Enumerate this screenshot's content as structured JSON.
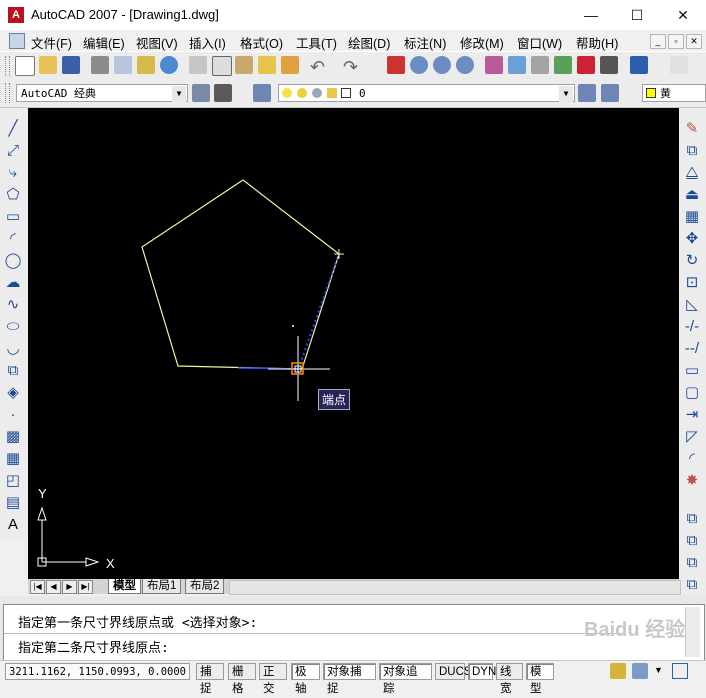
{
  "window": {
    "title": "AutoCAD 2007 - [Drawing1.dwg]",
    "app_icon_glyph": "A",
    "minimize": "—",
    "maximize": "☐",
    "close": "✕"
  },
  "menu": [
    "文件(F)",
    "编辑(E)",
    "视图(V)",
    "插入(I)",
    "格式(O)",
    "工具(T)",
    "绘图(D)",
    "标注(N)",
    "修改(M)",
    "窗口(W)",
    "帮助(H)"
  ],
  "mdi_controls": [
    "_",
    "▫",
    "✕"
  ],
  "toolbar2": {
    "workspace": "AutoCAD 经典",
    "layer": "0",
    "color": "黄"
  },
  "drawing": {
    "osnap_tooltip": "端点",
    "ucs_x": "X",
    "ucs_y": "Y"
  },
  "tabs": {
    "nav": [
      "|◀",
      "◀",
      "▶",
      "▶|"
    ],
    "items": [
      "模型",
      "布局1",
      "布局2"
    ],
    "active": "模型"
  },
  "command": {
    "line1": "指定第一条尺寸界线原点或 <选择对象>:",
    "line2": "指定第二条尺寸界线原点:"
  },
  "status": {
    "coords": "3211.1162, 1150.0993, 0.0000",
    "buttons": [
      {
        "label": "捕捉",
        "on": false
      },
      {
        "label": "栅格",
        "on": false
      },
      {
        "label": "正交",
        "on": false
      },
      {
        "label": "极轴",
        "on": true
      },
      {
        "label": "对象捕捉",
        "on": true
      },
      {
        "label": "对象追踪",
        "on": true
      },
      {
        "label": "DUCS",
        "on": false
      },
      {
        "label": "DYN",
        "on": true
      },
      {
        "label": "线宽",
        "on": false
      },
      {
        "label": "模型",
        "on": true
      }
    ]
  },
  "watermark": "Baidu 经验",
  "colors": {
    "drawing_bg": "#000000",
    "pentagon": "#f3f3a0",
    "tracking": "#2a4bff",
    "tooltip_bg": "#26265a",
    "snap_marker": "#ff8a00"
  }
}
